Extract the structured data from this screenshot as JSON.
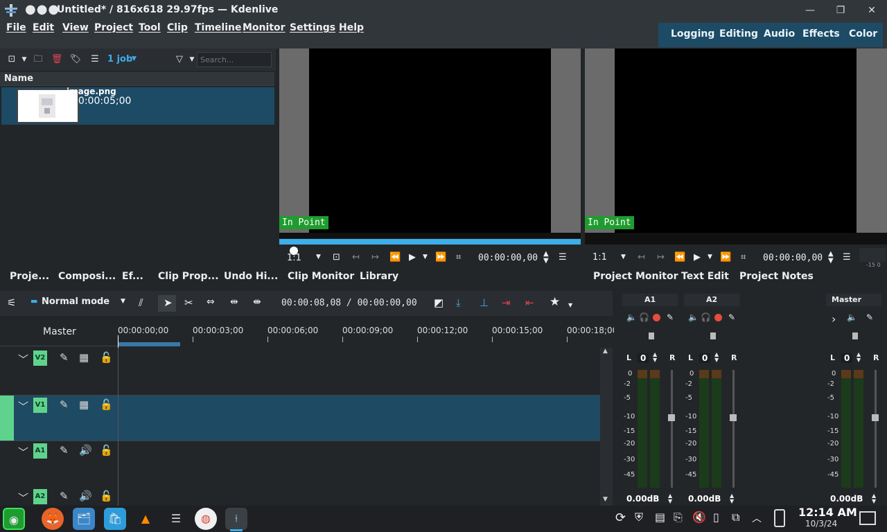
{
  "window": {
    "title": "Untitled* / 816x618 29.97fps — Kdenlive",
    "dots": "●●●",
    "minimize": "—",
    "maximize": "❐",
    "close": "✕"
  },
  "menu": {
    "file": "File",
    "edit": "Edit",
    "view": "View",
    "project": "Project",
    "tool": "Tool",
    "clip": "Clip",
    "timeline": "Timeline",
    "monitor": "Monitor",
    "settings": "Settings",
    "help": "Help"
  },
  "layouts": {
    "logging": "Logging",
    "editing": "Editing",
    "audio": "Audio",
    "effects": "Effects",
    "color": "Color"
  },
  "bin": {
    "job_label": "1 job",
    "search_placeholder": "Search...",
    "column_name": "Name",
    "clip_name": "image.png",
    "clip_duration": "00:00:05;00"
  },
  "left_tabs": {
    "project": "Proje...",
    "compositions": "Composi...",
    "effects": "Ef...",
    "clip_properties": "Clip Prop...",
    "undo_history": "Undo Hi..."
  },
  "clip_monitor": {
    "in_point": "In Point",
    "zoom": "1:1",
    "timecode": "00:00:00,00",
    "tab_clip_monitor": "Clip Monitor",
    "tab_library": "Library"
  },
  "project_monitor": {
    "in_point": "In Point",
    "zoom": "1:1",
    "timecode": "00:00:00,00",
    "tab_project_monitor": "Project Monitor",
    "tab_text_edit": "Text Edit",
    "tab_project_notes": "Project Notes"
  },
  "timeline": {
    "mode": "Normal mode",
    "position": "00:00:08,08 / 00:00:00,00",
    "master_label": "Master",
    "ruler": [
      "00:00:00;00",
      "00:00:03;00",
      "00:00:06;00",
      "00:00:09;00",
      "00:00:12;00",
      "00:00:15;00",
      "00:00:18;00"
    ],
    "tracks": [
      {
        "tag": "V2",
        "kind": "video"
      },
      {
        "tag": "V1",
        "kind": "video"
      },
      {
        "tag": "A1",
        "kind": "audio"
      },
      {
        "tag": "A2",
        "kind": "audio"
      }
    ]
  },
  "mixer": {
    "channels": [
      {
        "name": "A1",
        "gain": "0.00dB",
        "lr_value": "0"
      },
      {
        "name": "A2",
        "gain": "0.00dB",
        "lr_value": "0"
      },
      {
        "name": "Master",
        "gain": "0.00dB",
        "lr_value": "0"
      }
    ],
    "l_label": "L",
    "r_label": "R",
    "db_scale": [
      "0",
      "-2",
      "-5",
      "-10",
      "-15",
      "-20",
      "-30",
      "-45"
    ],
    "mini_meter_label": "-15 0"
  },
  "taskbar": {
    "clock_time": "12:14 AM",
    "clock_date": "10/3/24"
  },
  "colors": {
    "accent": "#1d4a64",
    "progress_blue": "#3daee9",
    "in_point_green": "#1f9c2f",
    "track_tag_green": "#5fd38d",
    "record_red": "#e74c3c"
  }
}
